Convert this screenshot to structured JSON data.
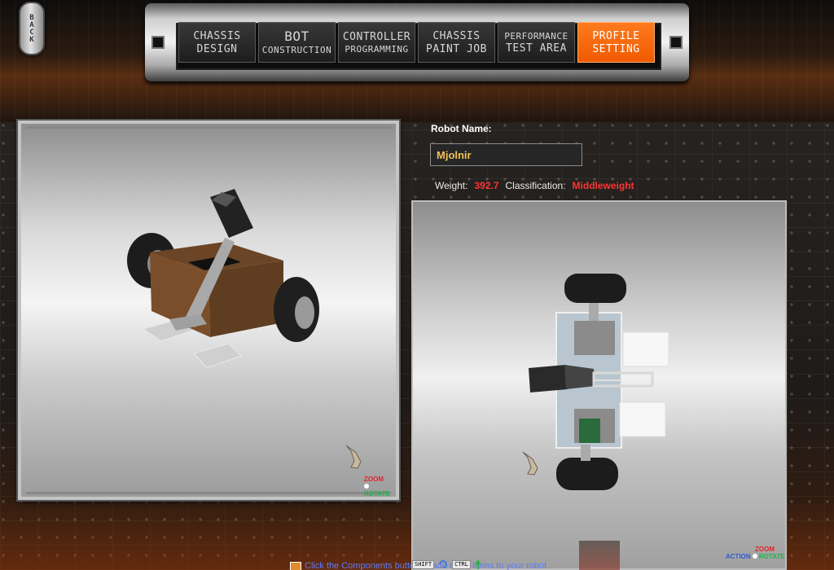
{
  "back_button": {
    "label": "BACK"
  },
  "nav": {
    "tabs": [
      {
        "line1": "CHASSIS",
        "line2": "DESIGN"
      },
      {
        "line1": "BOT",
        "line2": "CONSTRUCTION"
      },
      {
        "line1": "CONTROLLER",
        "line2": "PROGRAMMING"
      },
      {
        "line1": "CHASSIS",
        "line2": "PAINT JOB"
      },
      {
        "line1": "PERFORMANCE",
        "line2": "TEST AREA"
      },
      {
        "line1": "PROFILE",
        "line2": "SETTING"
      }
    ],
    "active_tab": "PROFILE SETTING"
  },
  "robot": {
    "name_label": "Robot Name:",
    "name_value": "Mjolnir",
    "weight_label": "Weight:",
    "weight_value": "392.7",
    "classification_label": "Classification:",
    "classification_value": "Middleweight"
  },
  "viewport_left": {
    "zoom_label": "ZOOM",
    "rotate_label": "ROTATE"
  },
  "viewport_right": {
    "action_label": "ACTION",
    "zoom_label": "ZOOM",
    "rotate_label": "ROTATE"
  },
  "hint": {
    "text": "Click the Components button to add more items to your robot",
    "key_shift": "SHIFT",
    "key_ctrl": "CTRL"
  },
  "colors": {
    "accent_orange": "#f05a00",
    "name_gold": "#f2c15a",
    "stat_red": "#ff3333"
  }
}
